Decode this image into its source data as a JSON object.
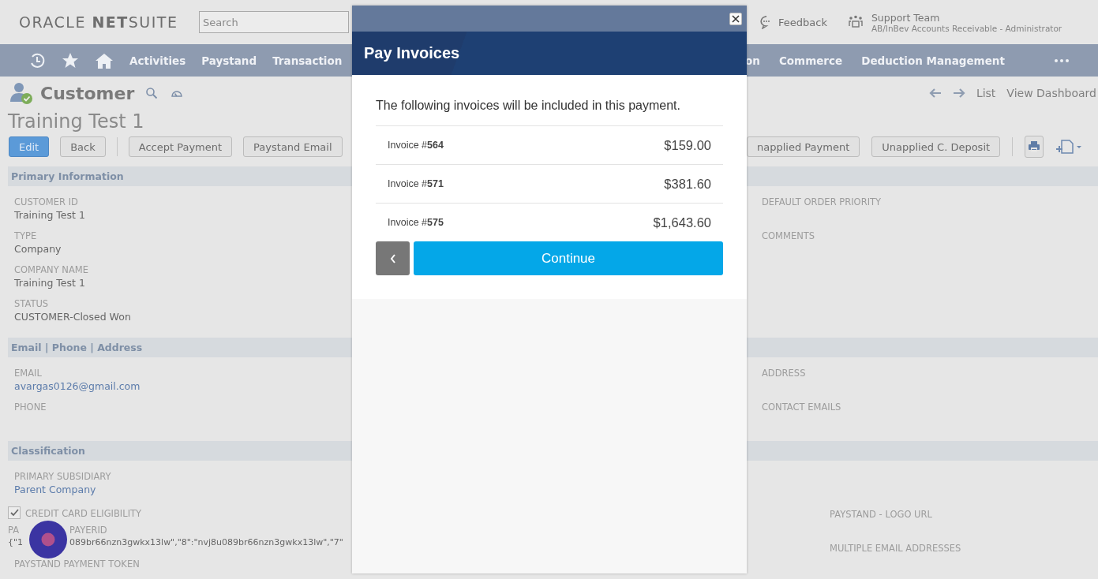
{
  "header": {
    "logo": "ORACLE **NET**SUITE",
    "search": {
      "placeholder": "Search"
    },
    "feedback": "Feedback",
    "user": {
      "name": "Support Team",
      "role": "AB/InBev Accounts Receivable - Administrator"
    }
  },
  "nav": {
    "left_items": [
      "Activities",
      "Paystand",
      "Transaction"
    ],
    "right_items": [
      "on",
      "Commerce",
      "Deduction Management"
    ]
  },
  "record": {
    "type": "Customer",
    "title": "Training Test 1",
    "links": [
      "List",
      "View Dashboard"
    ],
    "left_buttons": [
      {
        "label": "Edit",
        "kind": "primary"
      },
      {
        "label": "Back",
        "kind": "plain"
      },
      {
        "label": "Accept Payment",
        "kind": "plain"
      },
      {
        "label": "Paystand Email",
        "kind": "plain"
      }
    ],
    "right_buttons": [
      {
        "label": "napplied Payment",
        "kind": "plain"
      },
      {
        "label": "Unapplied C. Deposit",
        "kind": "plain"
      }
    ],
    "sections": [
      {
        "title": "Primary Information",
        "left": [
          {
            "kind": "field",
            "label": "CUSTOMER ID",
            "value": "Training Test 1"
          },
          {
            "kind": "field",
            "label": "TYPE",
            "value": "Company"
          },
          {
            "kind": "field",
            "label": "COMPANY NAME",
            "value": "Training Test 1"
          },
          {
            "kind": "field",
            "label": "STATUS",
            "value": "CUSTOMER-Closed Won"
          }
        ],
        "right": [
          {
            "kind": "field",
            "label": "DEFAULT ORDER PRIORITY"
          },
          {
            "kind": "field",
            "label": "COMMENTS"
          }
        ]
      },
      {
        "title": "Email | Phone | Address",
        "left": [
          {
            "kind": "link",
            "label": "EMAIL",
            "value": "avargas0126@gmail.com"
          },
          {
            "kind": "field",
            "label": "PHONE"
          }
        ],
        "right": [
          {
            "kind": "field",
            "label": "ADDRESS"
          },
          {
            "kind": "field",
            "label": "CONTACT EMAILS"
          }
        ]
      },
      {
        "title": "Classification",
        "left": [
          {
            "kind": "link",
            "label": "PRIMARY SUBSIDIARY",
            "value": "Parent Company"
          },
          {
            "kind": "checkbox",
            "label": "CREDIT CARD ELIGIBILITY",
            "checked": true
          },
          {
            "kind": "split",
            "label": [
              "PA",
              "PAYERID"
            ],
            "value": [
              "{\"1",
              "089br66nzn3gwkx13lw\",\"8\":\"nvj8u089br66nzn3gwkx13lw\",\"7\""
            ]
          },
          {
            "kind": "field",
            "label": "PAYSTAND PAYMENT TOKEN"
          }
        ],
        "right": [
          {
            "kind": "field",
            "label": "PAYSTAND - LOGO URL"
          },
          {
            "kind": "field",
            "label": "MULTIPLE EMAIL ADDRESSES"
          }
        ]
      }
    ]
  },
  "modal": {
    "title": "Pay Invoices",
    "intro": "The following invoices will be included in this payment.",
    "invoices": [
      {
        "label": "Invoice #**564**",
        "amount": "$159.00"
      },
      {
        "label": "Invoice #**571**",
        "amount": "$381.60"
      },
      {
        "label": "Invoice #**575**",
        "amount": "$1,643.60"
      }
    ],
    "continue": "Continue"
  }
}
